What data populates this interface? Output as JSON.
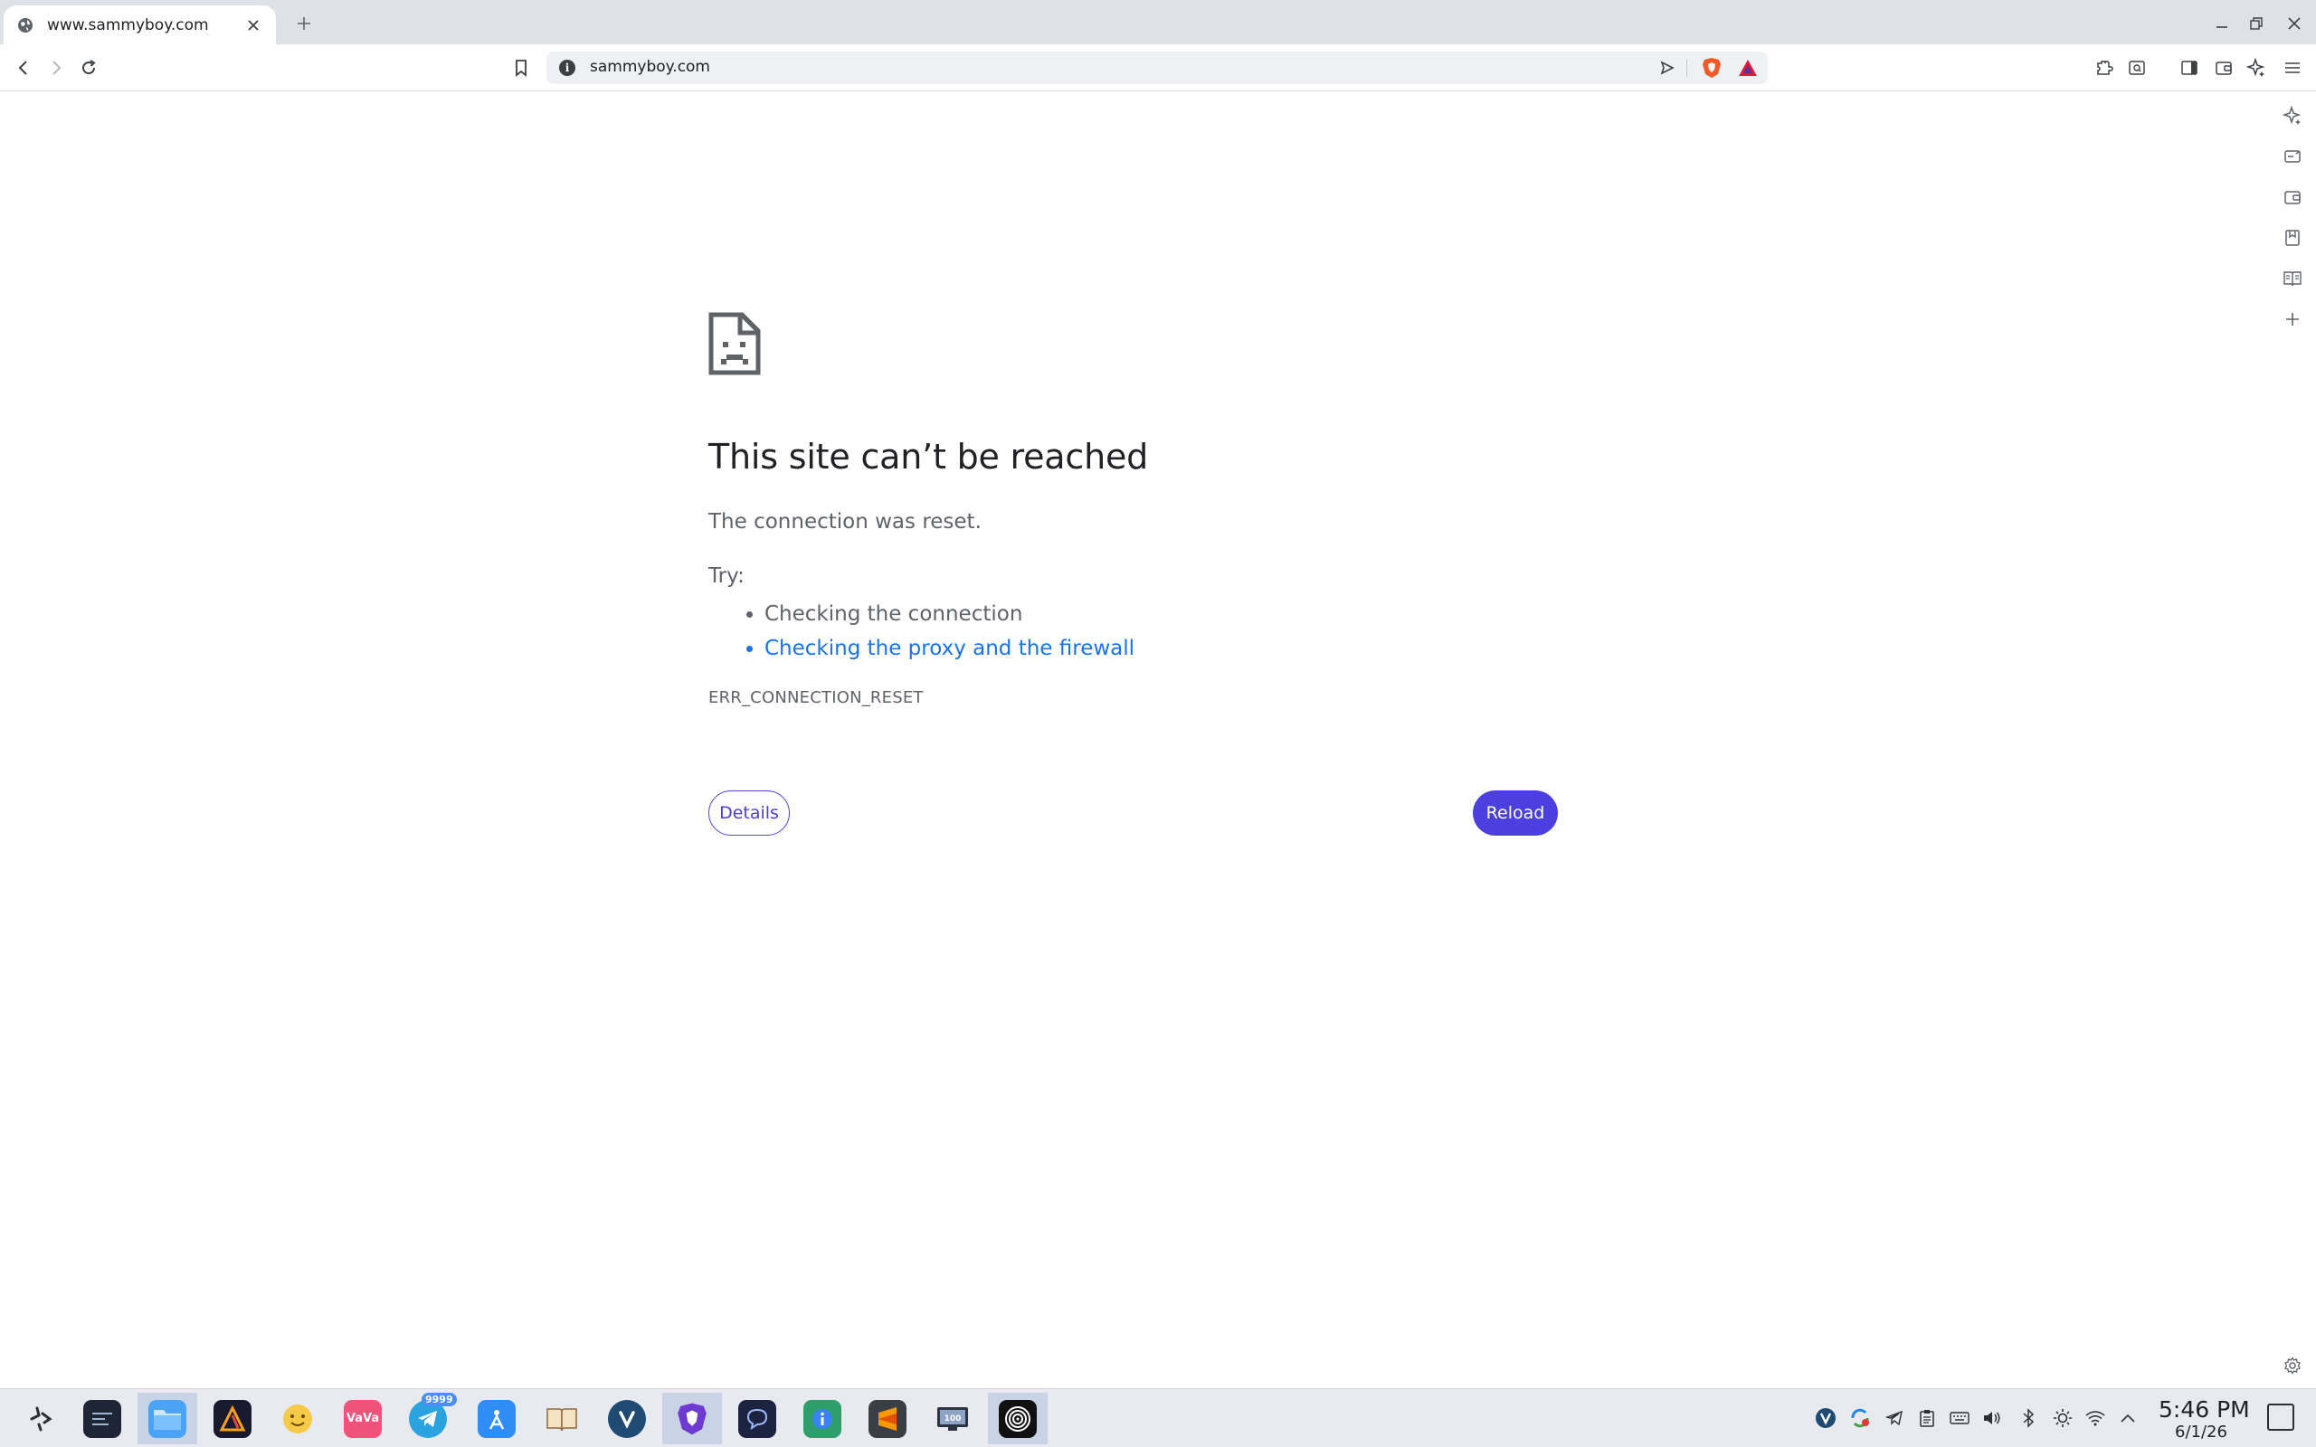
{
  "tab": {
    "title": "www.sammyboy.com",
    "favicon": "globe-icon",
    "close": "✕"
  },
  "window_controls": [
    "minimize-icon",
    "restore-icon",
    "close-icon"
  ],
  "toolbar": {
    "url": "sammyboy.com",
    "info_glyph": "i"
  },
  "side_panel": [
    "leo-ai-icon",
    "playlist-icon",
    "wallet-icon",
    "bookmarks-icon",
    "reading-list-icon",
    "add-icon",
    "settings-icon"
  ],
  "error": {
    "title": "This site can’t be reached",
    "description": "The connection was reset.",
    "try_label": "Try:",
    "suggestions": [
      "Checking the connection",
      "Checking the proxy and the firewall"
    ],
    "code": "ERR_CONNECTION_RESET",
    "details_label": "Details",
    "reload_label": "Reload"
  },
  "taskbar": {
    "apps": [
      {
        "name": "launcher",
        "label": ""
      },
      {
        "name": "terminal",
        "label": ""
      },
      {
        "name": "files",
        "label": ""
      },
      {
        "name": "affinity",
        "label": ""
      },
      {
        "name": "emoji",
        "label": ""
      },
      {
        "name": "vava",
        "label": "VaVa"
      },
      {
        "name": "telegram",
        "label": ""
      },
      {
        "name": "appstore",
        "label": ""
      },
      {
        "name": "book",
        "label": ""
      },
      {
        "name": "vivaldi",
        "label": ""
      },
      {
        "name": "brave",
        "label": ""
      },
      {
        "name": "chat",
        "label": ""
      },
      {
        "name": "info",
        "label": ""
      },
      {
        "name": "sublime",
        "label": ""
      },
      {
        "name": "monitor",
        "label": "100"
      },
      {
        "name": "spiral",
        "label": ""
      }
    ],
    "telegram_badge": "9999",
    "time": "5:46 PM",
    "date": "6/1/26"
  }
}
